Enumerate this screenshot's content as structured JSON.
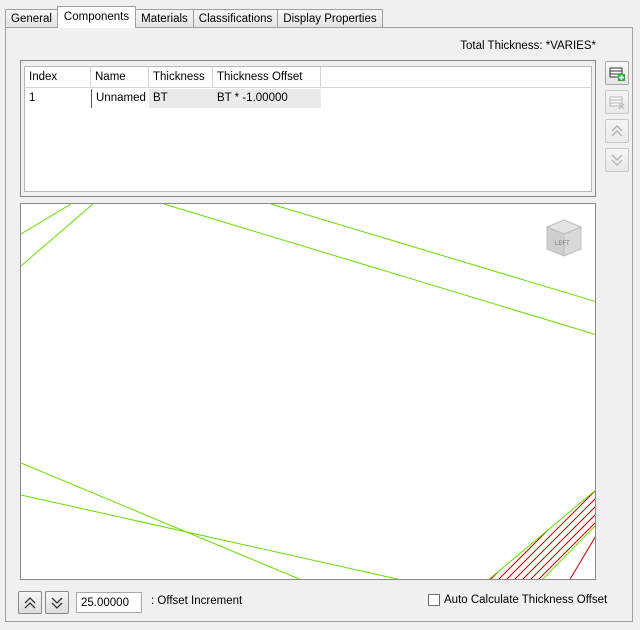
{
  "tabs": [
    {
      "label": "General"
    },
    {
      "label": "Components",
      "active": true
    },
    {
      "label": "Materials"
    },
    {
      "label": "Classifications"
    },
    {
      "label": "Display Properties"
    }
  ],
  "total_thickness": "Total Thickness: *VARIES*",
  "grid": {
    "columns": [
      "Index",
      "Name",
      "Thickness",
      "Thickness Offset"
    ],
    "rows": [
      {
        "index": "1",
        "name": "Unnamed",
        "thickness": "BT",
        "offset": "BT * -1.00000"
      }
    ]
  },
  "side_buttons": [
    {
      "name": "add-component-icon",
      "enabled": true
    },
    {
      "name": "remove-component-icon",
      "enabled": false
    },
    {
      "name": "move-up-icon",
      "enabled": false
    },
    {
      "name": "move-down-icon",
      "enabled": false
    }
  ],
  "viewcube": {
    "face_label": "LEFT"
  },
  "bottom": {
    "offset_increment_value": "25.00000",
    "offset_increment_label": ": Offset Increment",
    "auto_calc_label": "Auto Calculate Thickness Offset",
    "auto_calc_checked": false
  },
  "colors": {
    "component_line": "#66dd00",
    "hatch": "#cc0000"
  }
}
